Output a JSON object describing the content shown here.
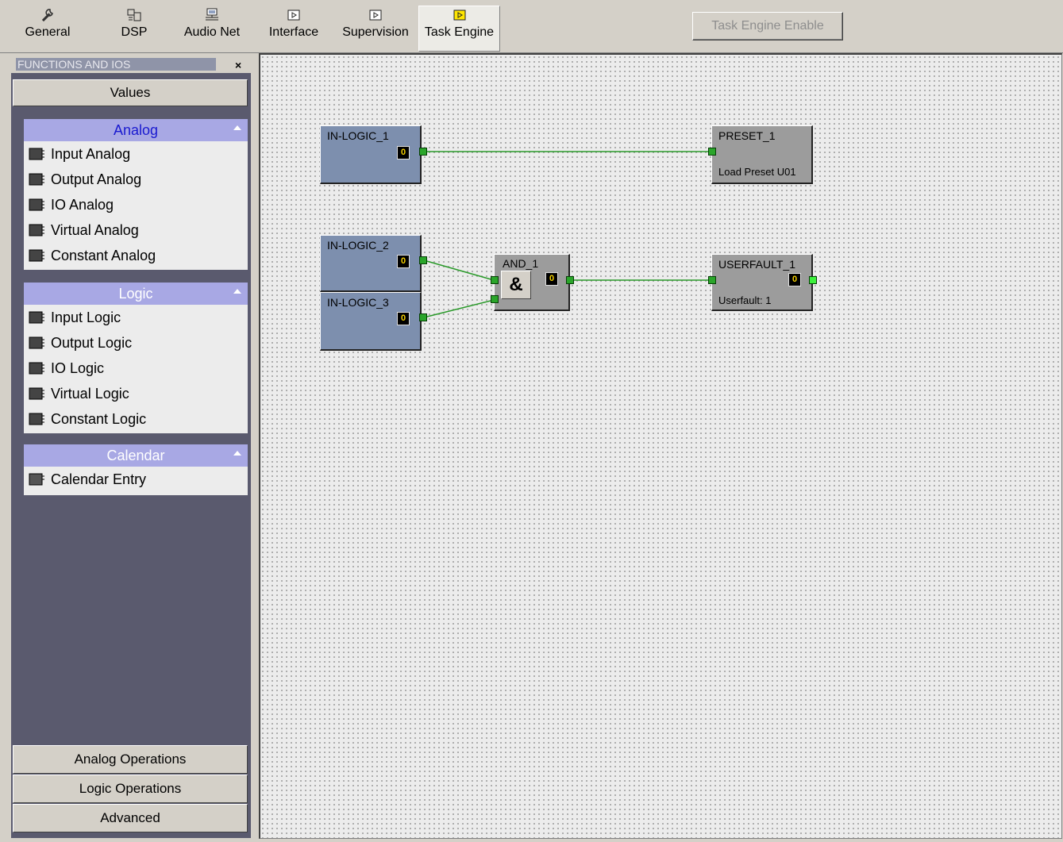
{
  "toolbar": {
    "tabs": [
      {
        "label": "General",
        "icon": "wrench-icon"
      },
      {
        "label": "DSP",
        "icon": "dsp-icon"
      },
      {
        "label": "Audio Net",
        "icon": "network-icon"
      },
      {
        "label": "Interface",
        "icon": "interface-icon"
      },
      {
        "label": "Supervision",
        "icon": "supervision-icon"
      },
      {
        "label": "Task Engine",
        "icon": "task-engine-icon"
      }
    ],
    "active_tab": "Task Engine",
    "enable_button": "Task Engine Enable"
  },
  "panel": {
    "title": "FUNCTIONS AND IOS",
    "close": "×",
    "values_button": "Values",
    "groups": [
      {
        "title": "Analog",
        "items": [
          "Input Analog",
          "Output Analog",
          "IO Analog",
          "Virtual Analog",
          "Constant Analog"
        ]
      },
      {
        "title": "Logic",
        "items": [
          "Input Logic",
          "Output Logic",
          "IO Logic",
          "Virtual Logic",
          "Constant Logic"
        ]
      },
      {
        "title": "Calendar",
        "items": [
          "Calendar Entry"
        ]
      }
    ],
    "bottom_buttons": [
      "Analog Operations",
      "Logic Operations",
      "Advanced"
    ]
  },
  "canvas": {
    "nodes": [
      {
        "name": "IN-LOGIC_1",
        "value": "0"
      },
      {
        "name": "IN-LOGIC_2",
        "value": "0"
      },
      {
        "name": "IN-LOGIC_3",
        "value": "0"
      },
      {
        "name": "AND_1",
        "symbol": "&",
        "value": "0"
      },
      {
        "name": "PRESET_1",
        "sub": "Load Preset U01"
      },
      {
        "name": "USERFAULT_1",
        "value": "0",
        "sub": "Userfault: 1"
      }
    ],
    "wire_color": "#2a9a2a"
  },
  "colors": {
    "group_header": "#a8a8e4",
    "active_group_text": "#1a1ad0",
    "panel_bg": "#5a5a6e",
    "logic_node": "#7d8fae",
    "function_node": "#9c9c9c",
    "value_text": "#f4d000"
  }
}
